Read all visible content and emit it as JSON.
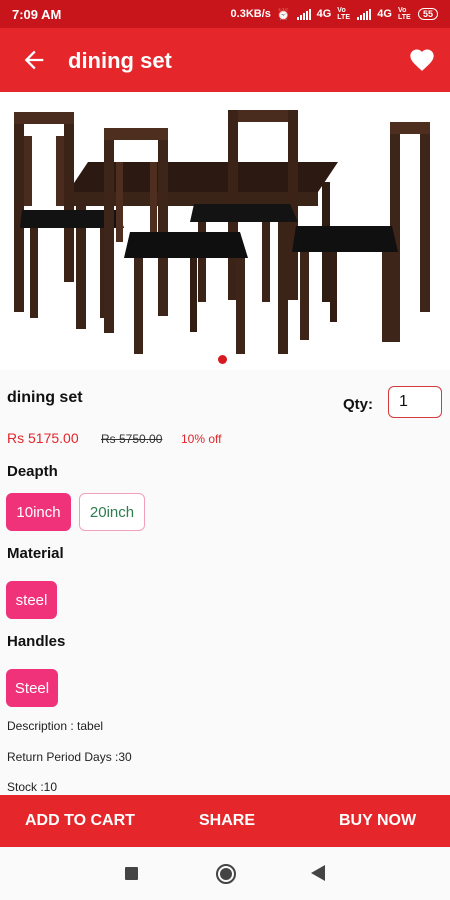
{
  "status": {
    "time": "7:09 AM",
    "speed": "0.3KB/s",
    "net1": "4G",
    "lte1": "Vo LTE",
    "net2": "4G",
    "lte2": "Vo LTE",
    "battery": "55"
  },
  "appbar": {
    "title": "dining set"
  },
  "product": {
    "name": "dining set",
    "qty_label": "Qty:",
    "qty_value": "1",
    "price": "Rs 5175.00",
    "mrp": "Rs 5750.00",
    "discount": "10% off",
    "image_icon": "dining-set-image",
    "carousel_dots": 1
  },
  "options": [
    {
      "label": "Deapth",
      "values": [
        {
          "text": "10inch",
          "selected": true
        },
        {
          "text": "20inch",
          "selected": false
        }
      ]
    },
    {
      "label": "Material",
      "values": [
        {
          "text": "steel",
          "selected": true
        }
      ]
    },
    {
      "label": "Handles",
      "values": [
        {
          "text": "Steel",
          "selected": true
        }
      ]
    }
  ],
  "details": {
    "description": "Description : tabel",
    "return": "Return Period Days :30",
    "stock": "Stock :10"
  },
  "actions": {
    "add_to_cart": "ADD TO CART",
    "share": "SHARE",
    "buy_now": "BUY NOW"
  },
  "colors": {
    "appbar": "#e5262a",
    "statusbar": "#c8151b",
    "chip_selected": "#f0327a",
    "price": "#e0262b",
    "chip_text_unselected": "#2e7d4f"
  },
  "navbar": {
    "icons": [
      "recents-square-icon",
      "home-circle-icon",
      "back-triangle-icon"
    ]
  }
}
